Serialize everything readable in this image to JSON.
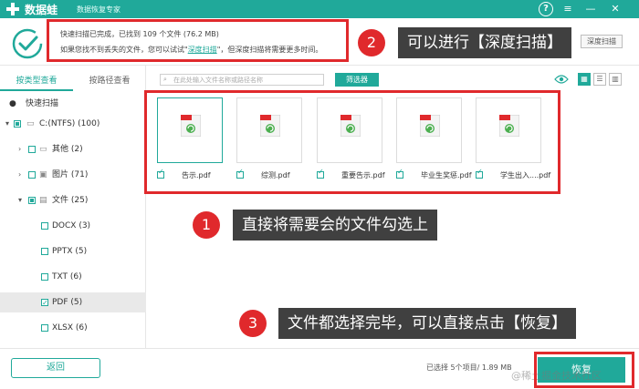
{
  "app": {
    "name": "数据蛙",
    "subtitle": "数据恢复专家",
    "colors": {
      "accent": "#20a99a",
      "annotation": "#e0292c",
      "label_bg": "#404040"
    }
  },
  "window": {
    "help": "?",
    "menu": "≡",
    "minimize": "—",
    "close": "✕"
  },
  "status": {
    "line1": "快速扫描已完成，已找到 109 个文件 (76.2 MB)",
    "line2_prefix": "如果您找不到丢失的文件，您可以试试\"",
    "deep_link": "深度扫描",
    "line2_suffix": "\"，但深度扫描将需要更多时间。",
    "deep_button": "深度扫描"
  },
  "sidebar": {
    "tabs": [
      "按类型查看",
      "按路径查看"
    ],
    "active_tab": 0,
    "items": [
      {
        "label": "快速扫描",
        "icon": "clock-icon"
      },
      {
        "label": "C:(NTFS) (100)",
        "icon": "drive-icon"
      },
      {
        "label": "其他 (2)",
        "icon": "folder-icon"
      },
      {
        "label": "图片 (71)",
        "icon": "image-icon"
      },
      {
        "label": "文件 (25)",
        "icon": "document-icon"
      },
      {
        "label": "DOCX (3)"
      },
      {
        "label": "PPTX (5)"
      },
      {
        "label": "TXT (6)"
      },
      {
        "label": "PDF (5)"
      },
      {
        "label": "XLSX (6)"
      }
    ]
  },
  "toolbar": {
    "search_placeholder": "在此处输入文件名称或路径名称",
    "filter_button": "筛选器",
    "view_icons": [
      "eye-icon",
      "grid-view-icon",
      "list-view-icon",
      "detail-view-icon"
    ]
  },
  "files": [
    {
      "name": "告示.pdf",
      "checked": true
    },
    {
      "name": "综测.pdf",
      "checked": true
    },
    {
      "name": "重要告示.pdf",
      "checked": true
    },
    {
      "name": "毕业生奖惩.pdf",
      "checked": true
    },
    {
      "name": "学生出入....pdf",
      "checked": true
    }
  ],
  "annotations": [
    {
      "number": "1",
      "text": "直接将需要会的文件勾选上"
    },
    {
      "number": "2",
      "text": "可以进行【深度扫描】"
    },
    {
      "number": "3",
      "text": "文件都选择完毕，可以直接点击【恢复】"
    }
  ],
  "bottom": {
    "back_button": "返回",
    "selection_summary": "已选择 5个项目/ 1.89 MB",
    "recover_button": "恢复",
    "watermark": "@稀土掘金技术社区"
  }
}
